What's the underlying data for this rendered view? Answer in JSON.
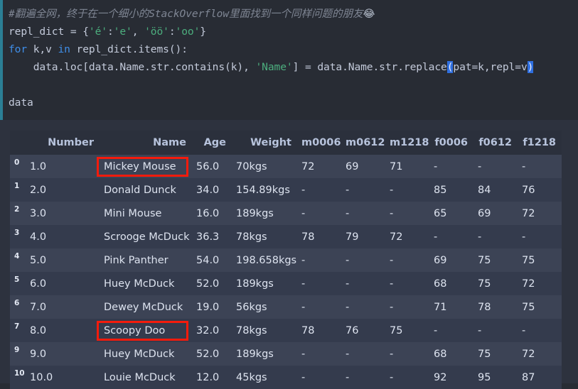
{
  "code_cell": {
    "accent_color": "#2b7f95",
    "background": "#282c34",
    "lines": [
      {
        "id": "line-comment",
        "tokens": [
          {
            "type": "comment",
            "text": "#翻遍全网，终于在一个细小的StackOverflow里面找到一个同样问题的朋友"
          },
          {
            "type": "emoji",
            "text": "😂"
          }
        ]
      },
      {
        "id": "line-repl-dict",
        "tokens": [
          {
            "type": "plain",
            "text": "repl_dict = {"
          },
          {
            "type": "string",
            "text": "'é'"
          },
          {
            "type": "plain",
            "text": ":"
          },
          {
            "type": "string",
            "text": "'e'"
          },
          {
            "type": "plain",
            "text": ", "
          },
          {
            "type": "string",
            "text": "'öö'"
          },
          {
            "type": "plain",
            "text": ":"
          },
          {
            "type": "string",
            "text": "'oo'"
          },
          {
            "type": "plain",
            "text": "}"
          }
        ]
      },
      {
        "id": "line-for",
        "tokens": [
          {
            "type": "keyword",
            "text": "for"
          },
          {
            "type": "plain",
            "text": " k,v "
          },
          {
            "type": "keyword",
            "text": "in"
          },
          {
            "type": "plain",
            "text": " repl_dict.items():"
          }
        ]
      },
      {
        "id": "line-loc-replace",
        "tokens": [
          {
            "type": "plain",
            "text": "    data.loc[data.Name.str.contains(k), "
          },
          {
            "type": "string",
            "text": "'Name'"
          },
          {
            "type": "plain",
            "text": "] = data.Name.str.replace"
          },
          {
            "type": "bracket",
            "text": "("
          },
          {
            "type": "plain",
            "text": "pat=k,repl=v"
          },
          {
            "type": "bracket",
            "text": ")"
          }
        ]
      },
      {
        "id": "line-blank",
        "tokens": [
          {
            "type": "plain",
            "text": " "
          }
        ]
      },
      {
        "id": "line-data",
        "tokens": [
          {
            "type": "plain",
            "text": "data"
          }
        ]
      }
    ]
  },
  "output": {
    "background": "#2d323e",
    "table": {
      "index_header": "",
      "columns": [
        "Number",
        "Name",
        "Age",
        "Weight",
        "m0006",
        "m0612",
        "m1218",
        "f0006",
        "f0612",
        "f1218"
      ],
      "highlight_color": "#f51b0c",
      "rows": [
        {
          "index": "0",
          "cells": [
            "1.0",
            "Mickey Mouse",
            "56.0",
            "70kgs",
            "72",
            "69",
            "71",
            "-",
            "-",
            "-"
          ],
          "highlight": "Name"
        },
        {
          "index": "1",
          "cells": [
            "2.0",
            "Donald Dunck",
            "34.0",
            "154.89kgs",
            "-",
            "-",
            "-",
            "85",
            "84",
            "76"
          ],
          "highlight": null
        },
        {
          "index": "2",
          "cells": [
            "3.0",
            "Mini Mouse",
            "16.0",
            "189kgs",
            "-",
            "-",
            "-",
            "65",
            "69",
            "72"
          ],
          "highlight": null
        },
        {
          "index": "3",
          "cells": [
            "4.0",
            "Scrooge McDuck",
            "36.3",
            "78kgs",
            "78",
            "79",
            "72",
            "-",
            "-",
            "-"
          ],
          "highlight": null
        },
        {
          "index": "4",
          "cells": [
            "5.0",
            "Pink Panther",
            "54.0",
            "198.658kgs",
            "-",
            "-",
            "-",
            "69",
            "75",
            "75"
          ],
          "highlight": null
        },
        {
          "index": "5",
          "cells": [
            "6.0",
            "Huey McDuck",
            "52.0",
            "189kgs",
            "-",
            "-",
            "-",
            "68",
            "75",
            "72"
          ],
          "highlight": null
        },
        {
          "index": "6",
          "cells": [
            "7.0",
            "Dewey McDuck",
            "19.0",
            "56kgs",
            "-",
            "-",
            "-",
            "71",
            "78",
            "75"
          ],
          "highlight": null
        },
        {
          "index": "7",
          "cells": [
            "8.0",
            "Scoopy Doo",
            "32.0",
            "78kgs",
            "78",
            "76",
            "75",
            "-",
            "-",
            "-"
          ],
          "highlight": "Name"
        },
        {
          "index": "9",
          "cells": [
            "9.0",
            "Huey McDuck",
            "52.0",
            "189kgs",
            "-",
            "-",
            "-",
            "68",
            "75",
            "72"
          ],
          "highlight": null
        },
        {
          "index": "10",
          "cells": [
            "10.0",
            "Louie McDuck",
            "12.0",
            "45kgs",
            "-",
            "-",
            "-",
            "92",
            "95",
            "87"
          ],
          "highlight": null
        }
      ]
    }
  }
}
